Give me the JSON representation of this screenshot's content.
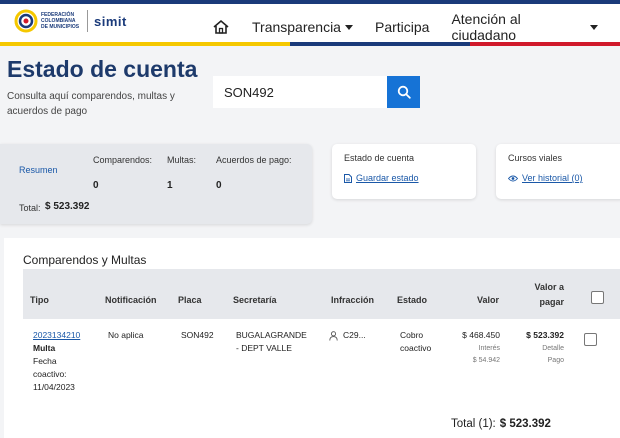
{
  "header": {
    "logo_text": "FEDERACIÓN COLOMBIANA DE MUNICIPIOS",
    "logo_brand": "simit",
    "nav": [
      {
        "label": "Transparencia",
        "dropdown": true
      },
      {
        "label": "Participa",
        "dropdown": false
      },
      {
        "label": "Atención al ciudadano",
        "dropdown": true
      }
    ]
  },
  "page": {
    "title": "Estado de cuenta",
    "subtitle": "Consulta aquí comparendos, multas y acuerdos de pago"
  },
  "search": {
    "value": "SON492"
  },
  "summary": {
    "resumen_label": "Resumen",
    "comparendos_label": "Comparendos:",
    "comparendos_value": "0",
    "multas_label": "Multas:",
    "multas_value": "1",
    "acuerdos_label": "Acuerdos de pago:",
    "acuerdos_value": "0",
    "total_label": "Total:",
    "total_value": "$ 523.392"
  },
  "estado_card": {
    "title": "Estado de cuenta",
    "action": "Guardar estado"
  },
  "cursos_card": {
    "title": "Cursos viales",
    "action": "Ver historial (0)"
  },
  "table": {
    "title": "Comparendos y Multas",
    "headers": {
      "tipo": "Tipo",
      "notificacion": "Notificación",
      "placa": "Placa",
      "secretaria": "Secretaría",
      "infraccion": "Infracción",
      "estado": "Estado",
      "valor": "Valor",
      "valor_pagar_1": "Valor a",
      "valor_pagar_2": "pagar"
    },
    "rows": [
      {
        "numero": "2023134210",
        "tipo": "Multa",
        "fecha_label_1": "Fecha",
        "fecha_label_2": "coactivo:",
        "fecha": "11/04/2023",
        "notificacion": "No aplica",
        "placa": "SON492",
        "secretaria_1": "BUGALAGRANDE",
        "secretaria_2": "- DEPT VALLE",
        "infraccion": "C29...",
        "estado_1": "Cobro",
        "estado_2": "coactivo",
        "valor": "$ 468.450",
        "interes_label": "Interés",
        "interes": "$ 54.942",
        "valor_pagar": "$ 523.392",
        "detalle_1": "Detalle",
        "detalle_2": "Pago"
      }
    ],
    "total_label": "Total (1):",
    "total_value": "$ 523.392"
  },
  "colors": {
    "brand": "#1d3a6b",
    "accent": "#1673d6",
    "link": "#1a58a8"
  }
}
